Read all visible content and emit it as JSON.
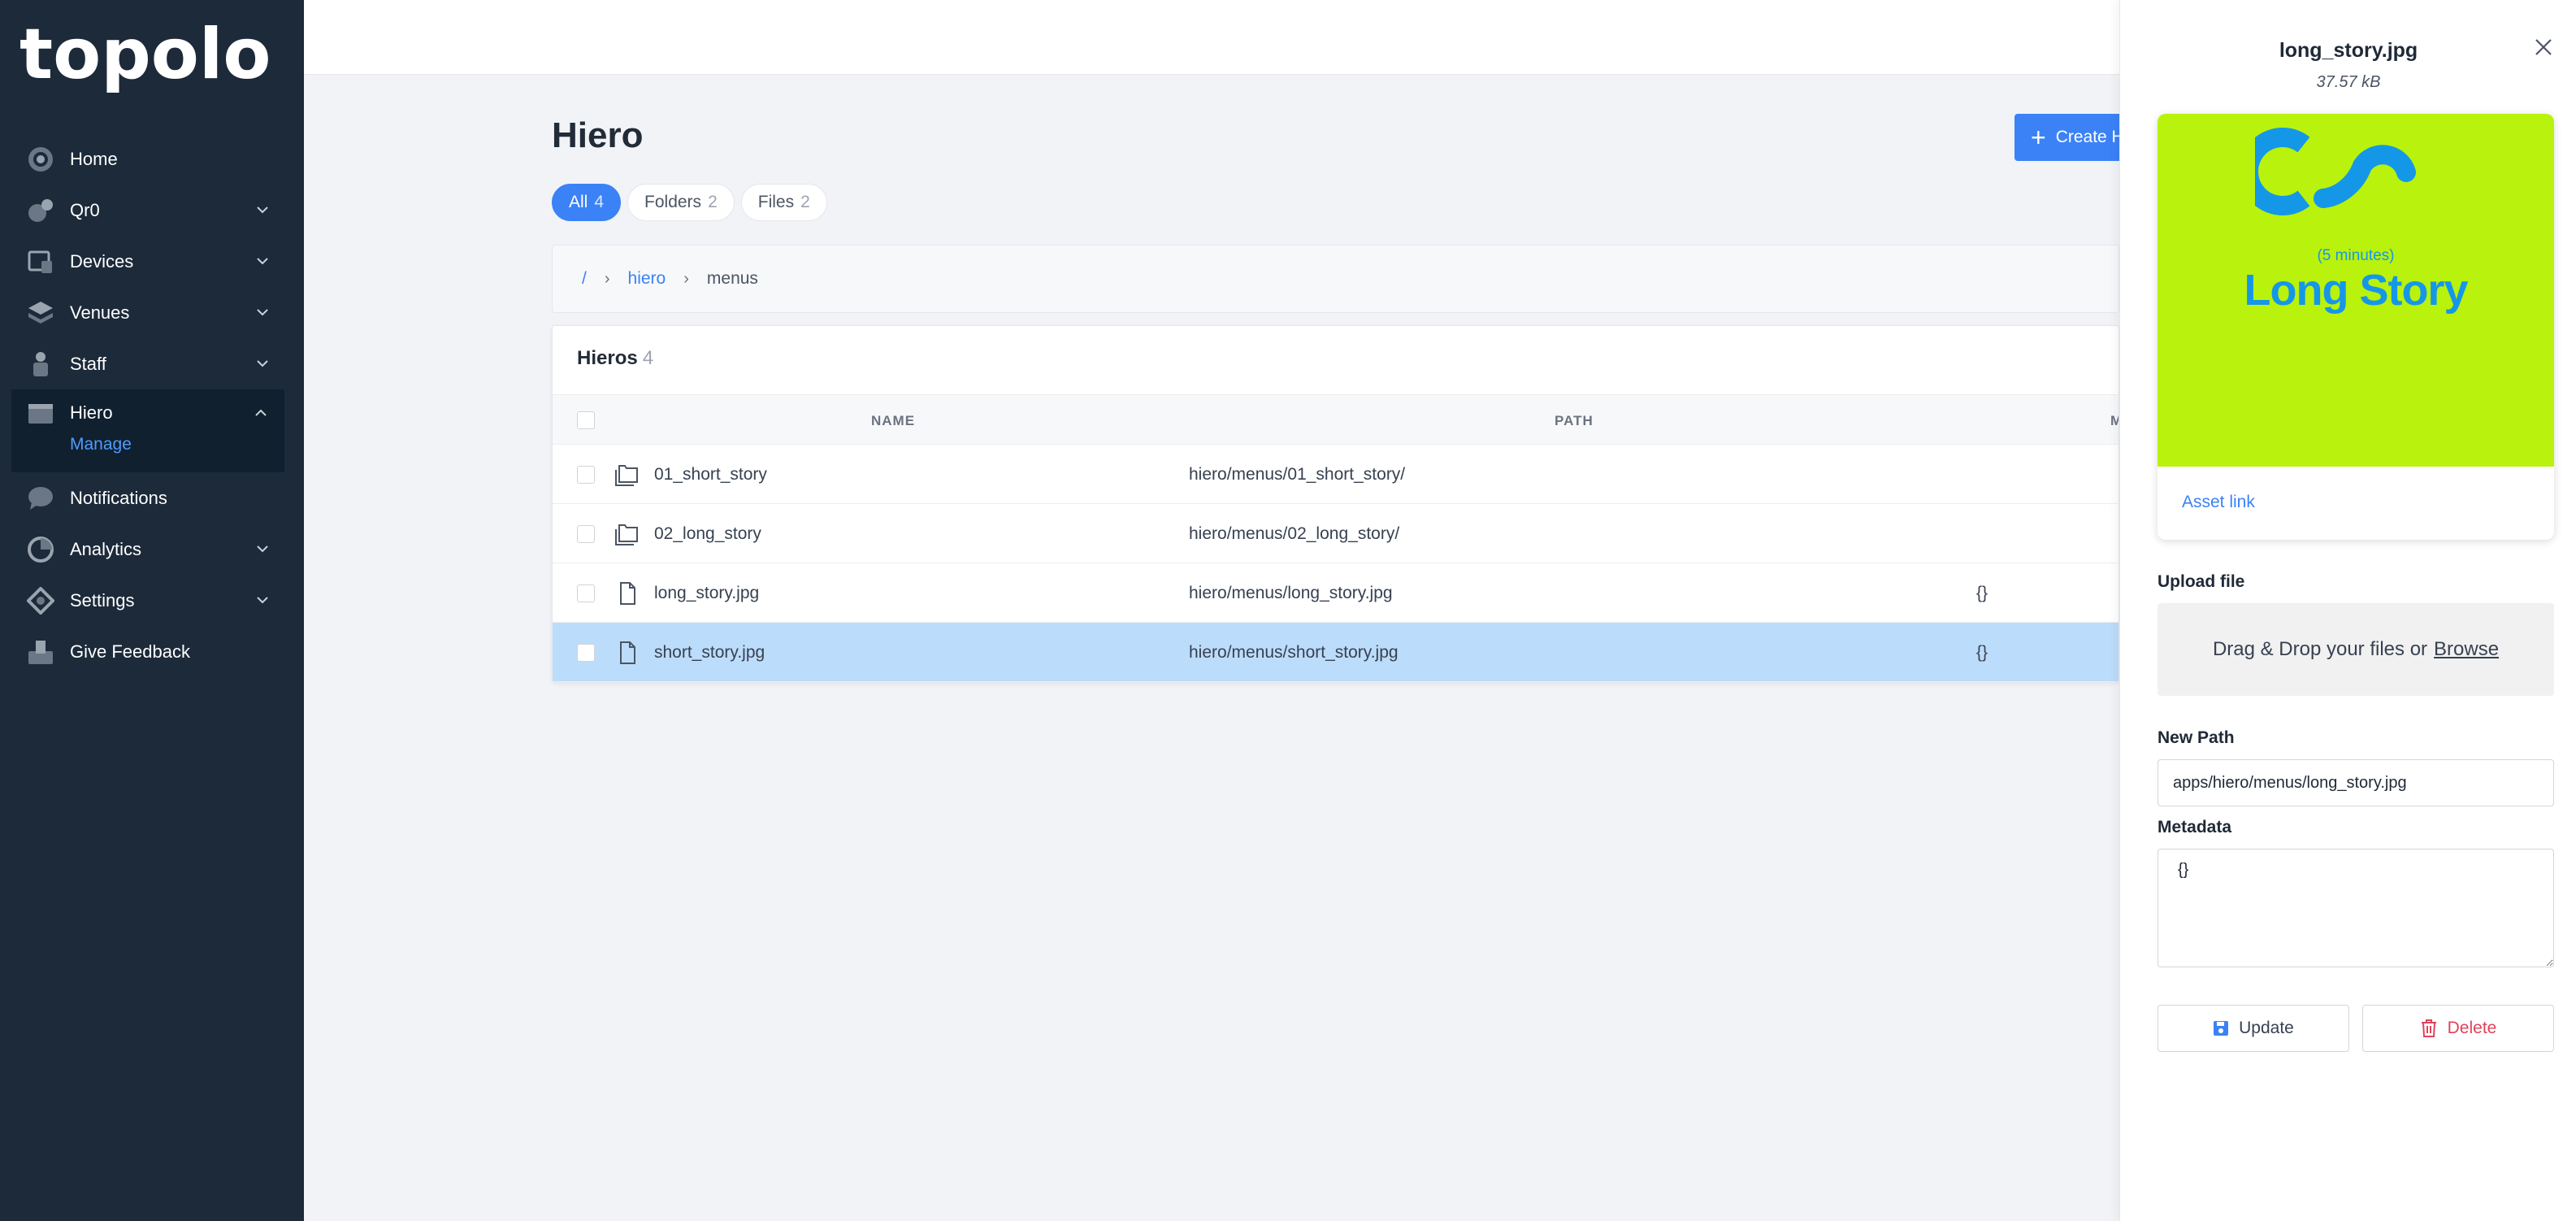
{
  "brand": {
    "logo_text": "topolo"
  },
  "sidebar": {
    "items": [
      {
        "label": "Home",
        "icon": "home-icon",
        "has_children": false
      },
      {
        "label": "Qr0",
        "icon": "qr-icon",
        "has_children": true
      },
      {
        "label": "Devices",
        "icon": "devices-icon",
        "has_children": true
      },
      {
        "label": "Venues",
        "icon": "venues-icon",
        "has_children": true
      },
      {
        "label": "Staff",
        "icon": "staff-icon",
        "has_children": true
      },
      {
        "label": "Hiero",
        "icon": "hiero-icon",
        "has_children": true,
        "expanded": true,
        "sub_label": "Manage"
      },
      {
        "label": "Notifications",
        "icon": "chat-bubble-icon",
        "has_children": false
      },
      {
        "label": "Analytics",
        "icon": "analytics-icon",
        "has_children": true
      },
      {
        "label": "Settings",
        "icon": "settings-icon",
        "has_children": true
      },
      {
        "label": "Give Feedback",
        "icon": "feedback-icon",
        "has_children": false
      }
    ]
  },
  "main": {
    "title": "Hiero",
    "create_label": "Create H",
    "filters": [
      {
        "label": "All",
        "count": "4",
        "active": true
      },
      {
        "label": "Folders",
        "count": "2",
        "active": false
      },
      {
        "label": "Files",
        "count": "2",
        "active": false
      }
    ],
    "breadcrumb": {
      "root": "/",
      "parent": "hiero",
      "current": "menus"
    },
    "table": {
      "title": "Hieros",
      "count": "4",
      "columns": {
        "name": "NAME",
        "path": "PATH",
        "meta": "M"
      },
      "rows": [
        {
          "name": "01_short_story",
          "path": "hiero/menus/01_short_story/",
          "meta": "",
          "type": "folder",
          "selected": false
        },
        {
          "name": "02_long_story",
          "path": "hiero/menus/02_long_story/",
          "meta": "",
          "type": "folder",
          "selected": false
        },
        {
          "name": "long_story.jpg",
          "path": "hiero/menus/long_story.jpg",
          "meta": "{}",
          "type": "file",
          "selected": false
        },
        {
          "name": "short_story.jpg",
          "path": "hiero/menus/short_story.jpg",
          "meta": "{}",
          "type": "file",
          "selected": true
        }
      ]
    }
  },
  "drawer": {
    "file_name": "long_story.jpg",
    "file_size": "37.57 kB",
    "preview": {
      "subtitle": "(5 minutes)",
      "title": "Long Story",
      "bg_color": "#b9f20c",
      "fg_color": "#1597e8"
    },
    "asset_link": "Asset link",
    "upload_label": "Upload file",
    "dropzone_text": "Drag & Drop your files or",
    "dropzone_browse": "Browse",
    "new_path_label": "New Path",
    "new_path_value": "apps/hiero/menus/long_story.jpg",
    "metadata_label": "Metadata",
    "metadata_value": "{}",
    "update_label": "Update",
    "delete_label": "Delete"
  },
  "colors": {
    "sidebar_bg": "#1c2a3a",
    "accent": "#3b82f6",
    "selected_row": "#bcdcfb",
    "danger": "#e0435c"
  }
}
